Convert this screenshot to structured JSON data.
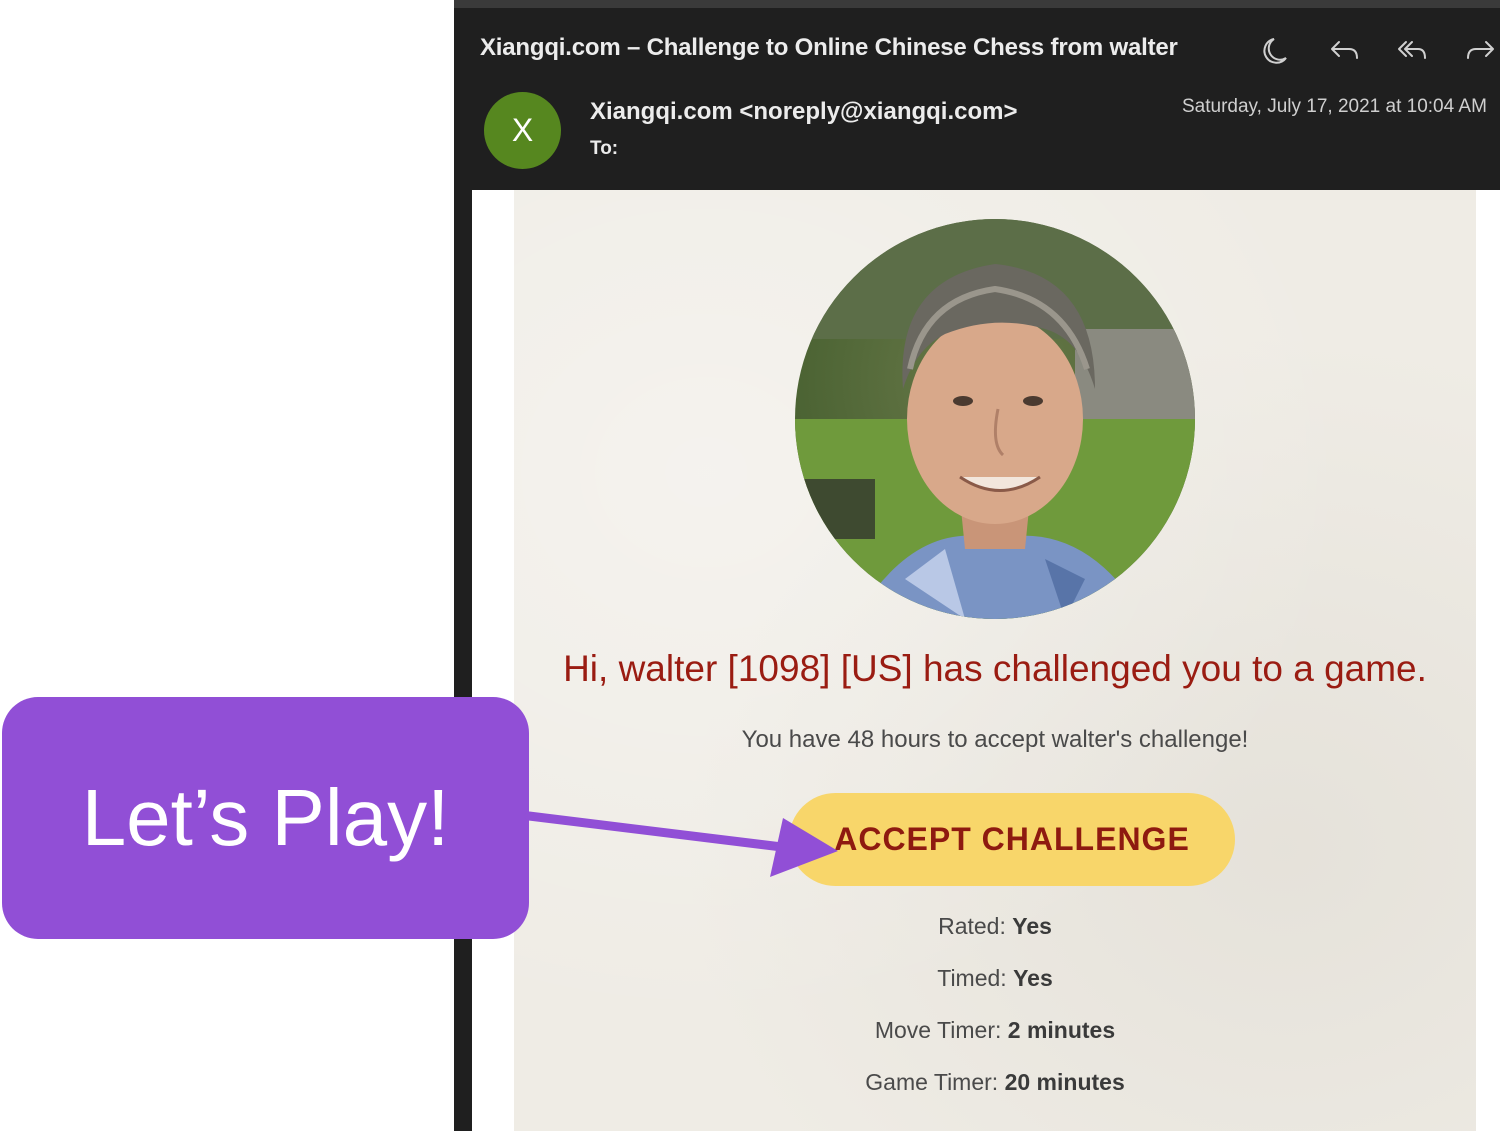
{
  "email": {
    "subject": "Xiangqi.com – Challenge to Online Chinese Chess from walter",
    "avatar_letter": "X",
    "sender": "Xiangqi.com <noreply@xiangqi.com>",
    "to_label": "To:",
    "date": "Saturday, July 17, 2021 at 10:04 AM"
  },
  "toolbar": {
    "icons": [
      "moon-icon",
      "reply-icon",
      "reply-all-icon",
      "forward-icon"
    ]
  },
  "body": {
    "headline": "Hi, walter [1098] [US] has challenged you to a game.",
    "subline": "You have 48 hours to accept walter's challenge!",
    "accept_label": "ACCEPT CHALLENGE",
    "details": [
      {
        "label": "Rated: ",
        "value": "Yes"
      },
      {
        "label": "Timed: ",
        "value": "Yes"
      },
      {
        "label": "Move Timer: ",
        "value": "2 minutes"
      },
      {
        "label": "Game Timer: ",
        "value": "20 minutes"
      }
    ]
  },
  "callout": {
    "text": "Let’s Play!"
  },
  "colors": {
    "callout": "#914fd6",
    "button": "#f8d66a",
    "headline": "#9a1c12",
    "avatar": "#56871f"
  }
}
